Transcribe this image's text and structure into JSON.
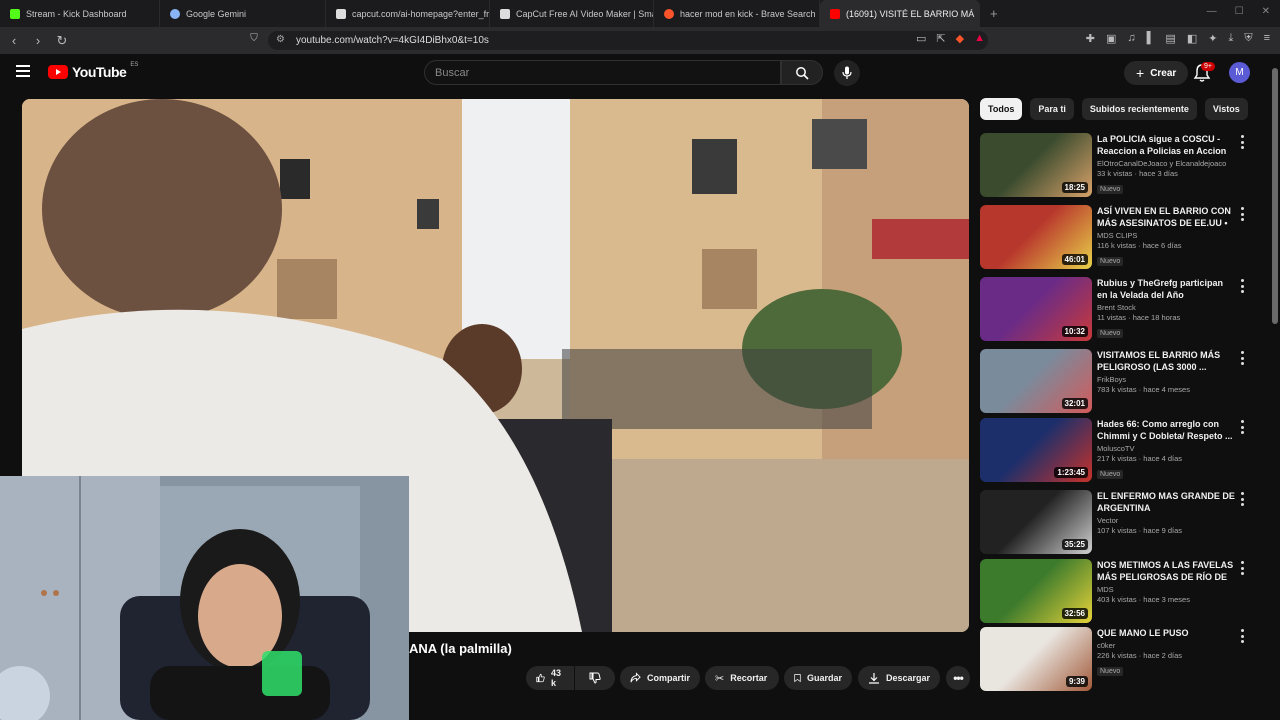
{
  "browser": {
    "tabs": [
      {
        "title": "Stream - Kick Dashboard",
        "color": "#53fc18"
      },
      {
        "title": "Google Gemini",
        "color": "#8ab4f8"
      },
      {
        "title": "capcut.com/ai-homepage?enter_fro",
        "color": "#ffffff"
      },
      {
        "title": "CapCut Free AI Video Maker | Smart",
        "color": "#ffffff"
      },
      {
        "title": "hacer mod en kick - Brave Search",
        "color": "#fb542b"
      },
      {
        "title": "(16091) VISITÉ EL BARRIO MÁ",
        "color": "#ff0000"
      }
    ],
    "url": "youtube.com/watch?v=4kGI4DiBhx0&t=10s"
  },
  "youtube": {
    "logo": "YouTube",
    "country": "ES",
    "search_placeholder": "Buscar",
    "create_label": "Crear",
    "notif_count": "9+",
    "avatar_letter": "M"
  },
  "video": {
    "title": "ANA (la palmilla)",
    "likes": "43 k",
    "share_label": "Compartir",
    "clip_label": "Recortar",
    "save_label": "Guardar",
    "download_label": "Descargar"
  },
  "chips": [
    "Todos",
    "Para ti",
    "Subidos recientemente",
    "Vistos"
  ],
  "sidebar": [
    {
      "title": "La POLICIA sigue a COSCU - Reaccion a Policias en Accion",
      "channel": "ElOtroCanalDeJoaco y Elcanaldejoaco",
      "views": "33 k vistas · hace 3 días",
      "badge": "Nuevo",
      "duration": "18:25",
      "c1": "#3a4b2e",
      "c2": "#d9a26a"
    },
    {
      "title": "ASÍ VIVEN EN EL BARRIO CON MÁS ASESINATOS DE EE.UU • ...",
      "channel": "MDS CLIPS",
      "views": "116 k vistas · hace 6 días",
      "badge": "Nuevo",
      "duration": "46:01",
      "c1": "#b8372c",
      "c2": "#e8d24a"
    },
    {
      "title": "Rubius y TheGrefg participan en la Velada del Año",
      "channel": "Brent Stock",
      "views": "11 vistas · hace 18 horas",
      "badge": "Nuevo",
      "duration": "10:32",
      "c1": "#6a2b86",
      "c2": "#c93a3a"
    },
    {
      "title": "VISITAMOS EL BARRIO MÁS PELIGROSO (LAS 3000 ...",
      "channel": "FrikBoys",
      "views": "783 k vistas · hace 4 meses",
      "badge": "",
      "duration": "32:01",
      "c1": "#7a8b9c",
      "c2": "#d35a5a"
    },
    {
      "title": "Hades 66: Como arreglo con Chimmi y C Dobleta/ Respeto ...",
      "channel": "MoluscoTV",
      "views": "217 k vistas · hace 4 días",
      "badge": "Nuevo",
      "duration": "1:23:45",
      "c1": "#1d2f6b",
      "c2": "#c8322a"
    },
    {
      "title": "EL ENFERMO MAS GRANDE DE ARGENTINA",
      "channel": "Vector",
      "views": "107 k vistas · hace 9 días",
      "badge": "",
      "duration": "35:25",
      "c1": "#222222",
      "c2": "#d2d2d2"
    },
    {
      "title": "NOS METIMOS A LAS FAVELAS MÁS PELIGROSAS DE RÍO DE ...",
      "channel": "MDS",
      "views": "403 k vistas · hace 3 meses",
      "badge": "",
      "duration": "32:56",
      "c1": "#3c7a2c",
      "c2": "#e7d33a"
    },
    {
      "title": "QUE MANO LE PUSO",
      "channel": "c0ker",
      "views": "226 k vistas · hace 2 días",
      "badge": "Nuevo",
      "duration": "9:39",
      "c1": "#e9e6e0",
      "c2": "#a25a3a"
    }
  ]
}
